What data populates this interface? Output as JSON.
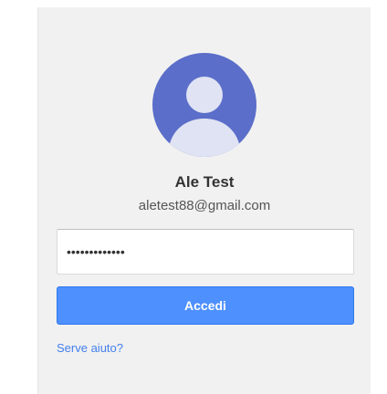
{
  "account": {
    "name": "Ale Test",
    "email": "aletest88@gmail.com",
    "avatar_color": "#5b6ec9"
  },
  "password_field": {
    "value": "•••••••••••••"
  },
  "signin_button": {
    "label": "Accedi",
    "color": "#4d90fe"
  },
  "help_link": {
    "label": "Serve aiuto?",
    "color": "#427fed"
  },
  "icons": {
    "avatar": "default-user-icon"
  }
}
